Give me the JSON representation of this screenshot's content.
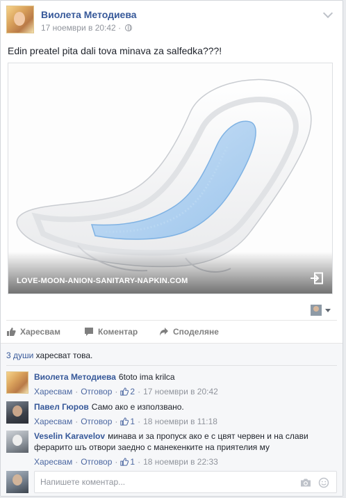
{
  "post": {
    "author": "Виолета Методиева",
    "timestamp": "17 ноември в 20:42",
    "meta_separator": "·",
    "audience_icon": "globe-icon",
    "text": "Edin preatel pita dali tova minava za salfedka???!"
  },
  "link_preview": {
    "domain": "LOVE-MOON-ANION-SANITARY-NAPKIN.COM",
    "share_icon": "share-arrow-icon"
  },
  "actions": {
    "like": "Харесвам",
    "comment": "Коментар",
    "share": "Споделяне"
  },
  "likes_summary": {
    "count_link": "3 души",
    "suffix": " харесват това."
  },
  "comments": [
    {
      "name": "Виолета Методиева",
      "text": "6toto ima krilca",
      "like": "Харесвам",
      "reply": "Отговор",
      "likes": "2",
      "time": "17 ноември в 20:42"
    },
    {
      "name": "Павел Гюров",
      "text": "Само ако е използвано.",
      "like": "Харесвам",
      "reply": "Отговор",
      "likes": "1",
      "time": "18 ноември в 11:18"
    },
    {
      "name": "Veselin Karavelov",
      "text": "минава и за пропуск ако е с цвят червен и на слави ферарито шъ отвори заедно с манекенките на приятелия му",
      "like": "Харесвам",
      "reply": "Отговор",
      "likes": "1",
      "time": "18 ноември в 22:33"
    }
  ],
  "composer": {
    "placeholder": "Напишете коментар..."
  },
  "colors": {
    "link": "#365899",
    "meta": "#90949c",
    "action": "#7f7f7f",
    "ufi_bg": "#f6f7f9"
  }
}
